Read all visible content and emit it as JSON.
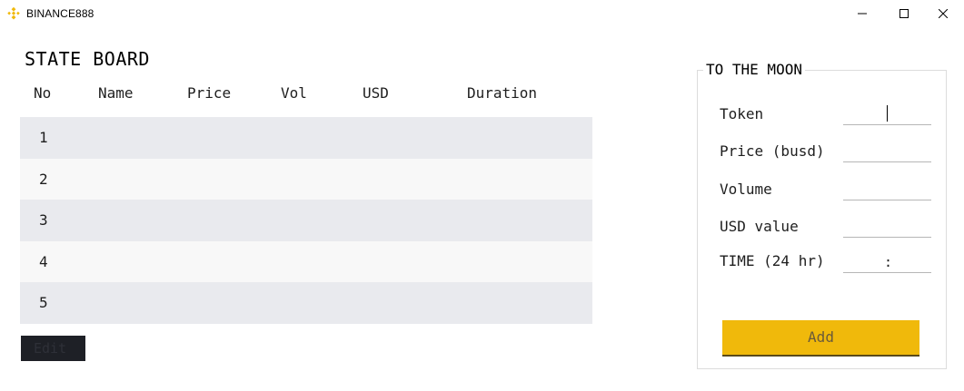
{
  "window": {
    "title": "BINANCE888",
    "controls": [
      "minimize",
      "maximize",
      "close"
    ]
  },
  "board": {
    "title": "STATE BOARD",
    "columns": [
      "No",
      "Name",
      "Price",
      "Vol",
      "USD",
      "Duration"
    ],
    "rows": [
      {
        "no": "1"
      },
      {
        "no": "2"
      },
      {
        "no": "3"
      },
      {
        "no": "4"
      },
      {
        "no": "5"
      }
    ],
    "edit_label": "Edit"
  },
  "panel": {
    "title": "TO THE MOON",
    "fields": {
      "token": {
        "label": "Token",
        "value": ""
      },
      "price": {
        "label": "Price (busd)",
        "value": ""
      },
      "volume": {
        "label": "Volume",
        "value": ""
      },
      "usd": {
        "label": "USD value",
        "value": ""
      },
      "time": {
        "label": "TIME (24 hr)",
        "separator": ":",
        "value": ""
      }
    },
    "add_label": "Add"
  },
  "colors": {
    "accent": "#f0b90b",
    "edit_button_bg": "#1e2026",
    "row_shaded": "#e9eaee",
    "row_light": "#f8f8f8",
    "panel_border": "#dcdcdc"
  },
  "icons": {
    "app_logo": "binance-logo-icon",
    "minimize": "minimize-icon",
    "maximize": "maximize-icon",
    "close": "close-icon"
  }
}
